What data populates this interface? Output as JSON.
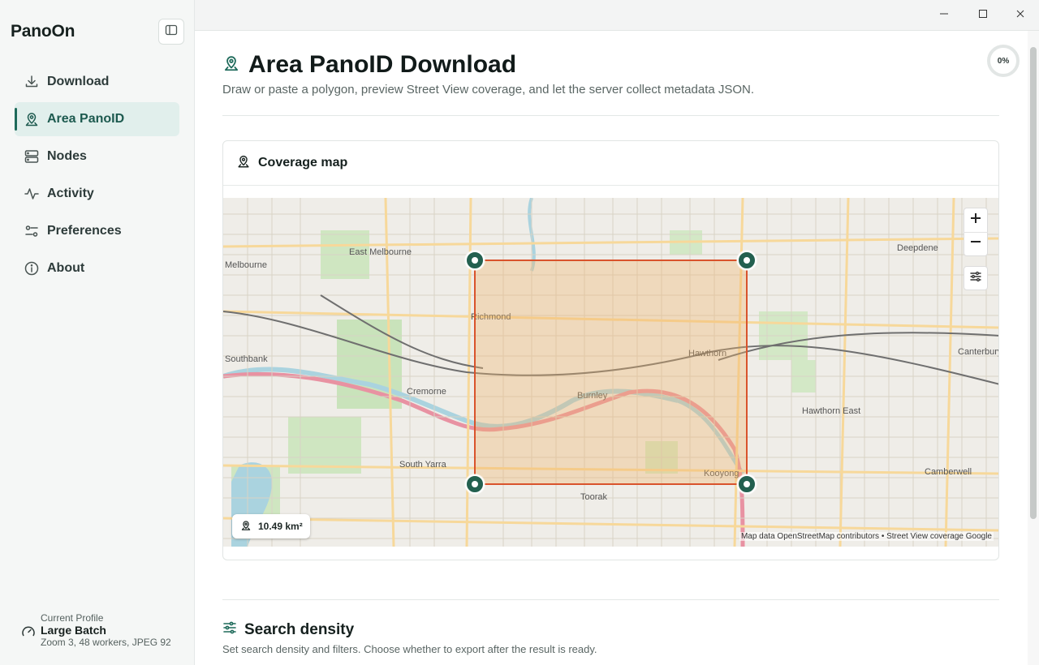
{
  "app": {
    "name": "PanoOn"
  },
  "sidebar": {
    "items": [
      {
        "label": "Download",
        "icon": "download-icon",
        "active": false
      },
      {
        "label": "Area PanoID",
        "icon": "map-pin-icon",
        "active": true
      },
      {
        "label": "Nodes",
        "icon": "server-icon",
        "active": false
      },
      {
        "label": "Activity",
        "icon": "activity-icon",
        "active": false
      },
      {
        "label": "Preferences",
        "icon": "sliders-icon",
        "active": false
      },
      {
        "label": "About",
        "icon": "info-icon",
        "active": false
      }
    ],
    "profile": {
      "caption": "Current Profile",
      "name": "Large Batch",
      "detail": "Zoom 3, 48 workers, JPEG 92"
    }
  },
  "page": {
    "title": "Area PanoID Download",
    "subtitle": "Draw or paste a polygon, preview Street View coverage, and let the server collect metadata JSON.",
    "progress_label": "0%",
    "progress_value": 0
  },
  "coverage": {
    "title": "Coverage map",
    "area_label": "10.49 km²",
    "attribution": "Map data OpenStreetMap contributors • Street View coverage Google",
    "map_labels": [
      "East Melbourne",
      "Richmond",
      "Hawthorn",
      "Cremorne",
      "Burnley",
      "South Yarra",
      "Toorak",
      "Kooyong",
      "Hawthorn East",
      "Camberwell",
      "Deepdene",
      "Canterbury",
      "Melbourne",
      "Southbank"
    ]
  },
  "density": {
    "title": "Search density",
    "subtitle": "Set search density and filters. Choose whether to export after the result is ready."
  },
  "colors": {
    "accent": "#1e6a5a",
    "polygon_stroke": "#d9532c",
    "polygon_fill": "#f2b46b"
  }
}
